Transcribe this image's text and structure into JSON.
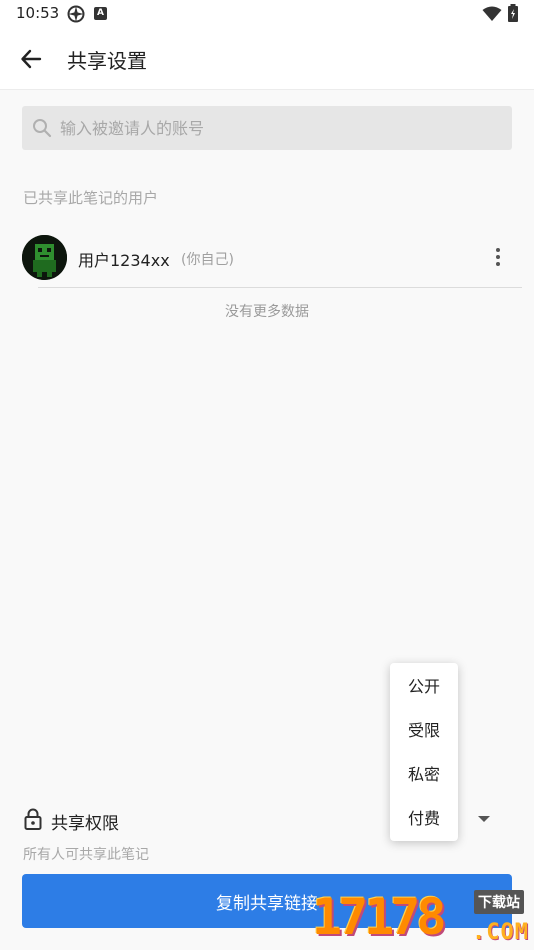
{
  "status_bar": {
    "time": "10:53",
    "notification_icon_text": "A"
  },
  "header": {
    "title": "共享设置"
  },
  "search": {
    "placeholder": "输入被邀请人的账号"
  },
  "shared_users": {
    "section_label": "已共享此笔记的用户",
    "users": [
      {
        "name": "用户1234xx",
        "note": "(你自己)"
      }
    ],
    "empty_text": "没有更多数据"
  },
  "permission": {
    "label": "共享权限",
    "description": "所有人可共享此笔记",
    "options": [
      "公开",
      "受限",
      "私密",
      "付费"
    ]
  },
  "copy_button": {
    "label": "复制共享链接"
  },
  "watermark": {
    "digits": "17178",
    "badge": "下载站",
    "suffix": ".COM"
  },
  "colors": {
    "accent": "#2d7de6",
    "background": "#f9f9f9"
  }
}
